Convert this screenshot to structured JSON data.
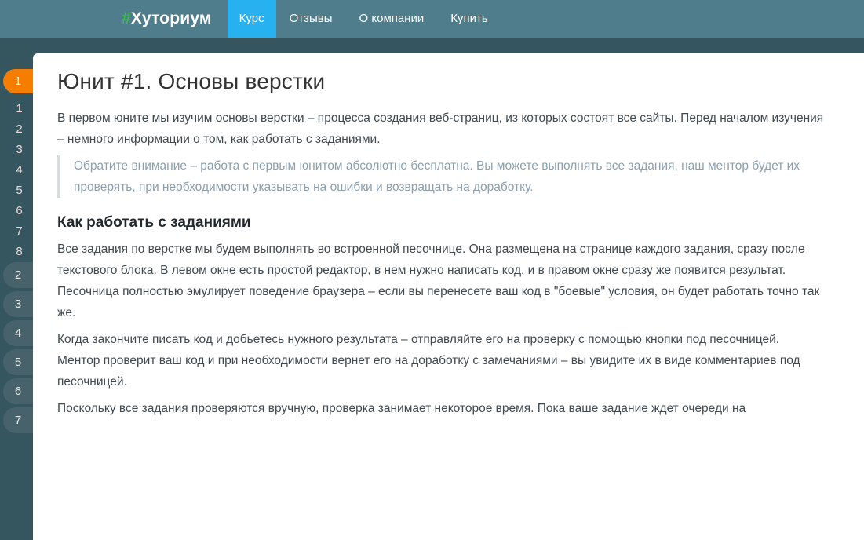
{
  "brand": {
    "hash": "#",
    "name": "Хуториум"
  },
  "nav": [
    {
      "label": "Курс",
      "active": true
    },
    {
      "label": "Отзывы",
      "active": false
    },
    {
      "label": "О компании",
      "active": false
    },
    {
      "label": "Купить",
      "active": false
    }
  ],
  "sidebar": {
    "active_unit": "1",
    "lessons": [
      "1",
      "2",
      "3",
      "4",
      "5",
      "6",
      "7",
      "8"
    ],
    "other_units": [
      "2",
      "3",
      "4",
      "5",
      "6",
      "7"
    ]
  },
  "content": {
    "title": "Юнит #1. Основы верстки",
    "intro": "В первом юните мы изучим основы верстки – процесса создания веб-страниц, из которых состоят все сайты. Перед началом изучения – немного информации о том, как работать с заданиями.",
    "notice": "Обратите внимание – работа с первым юнитом абсолютно бесплатна. Вы можете выполнять все задания, наш ментор будет их проверять, при необходимости указывать на ошибки и возвращать на доработку.",
    "subtitle": "Как работать с заданиями",
    "paragraphs": [
      "Все задания по верстке мы будем выполнять во встроенной песочнице. Она размещена на странице каждого задания, сразу после текстового блока. В левом окне есть простой редактор, в нем нужно написать код, и в правом окне сразу же появится результат. Песочница полностью эмулирует поведение браузера – если вы перенесете ваш код в \"боевые\" условия, он будет работать точно так же.",
      "Когда закончите писать код и добьетесь нужного результата – отправляйте его на проверку с помощью кнопки под песочницей. Ментор проверит ваш код и при необходимости вернет его на доработку с замечаниями – вы увидите их в виде комментариев под песочницей.",
      "Поскольку все задания проверяются вручную, проверка занимает некоторое время. Пока ваше задание ждет очереди на"
    ]
  },
  "colors": {
    "navbar_bg": "#4f7d8b",
    "active_nav_bg": "#28b1f1",
    "brand_hash_green": "#3eba4d",
    "page_bg": "#36565f",
    "unit_pill_bg": "#47626b",
    "active_unit_orange": "#f57d02",
    "notice_text": "#8b9fae",
    "body_text": "#40494f"
  }
}
